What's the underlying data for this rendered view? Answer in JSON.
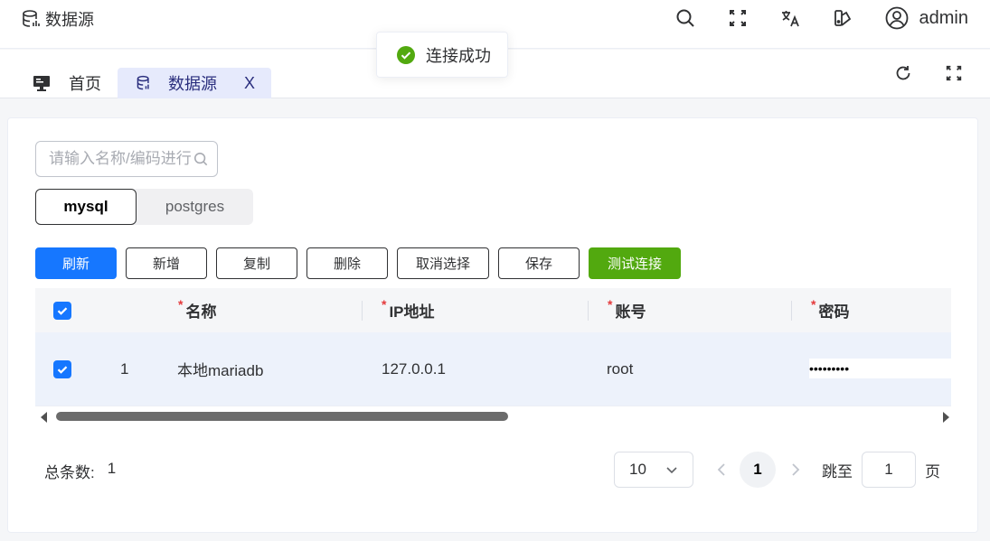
{
  "header": {
    "title": "数据源",
    "icons": [
      "search-icon",
      "fullscreen-icon",
      "translate-icon",
      "theme-icon",
      "user-icon"
    ],
    "username": "admin"
  },
  "tabs": [
    {
      "label": "首页",
      "icon": "monitor-icon",
      "active": false
    },
    {
      "label": "数据源",
      "icon": "database-icon",
      "active": true,
      "close": "X"
    }
  ],
  "toast": {
    "message": "连接成功",
    "type": "success"
  },
  "search": {
    "placeholder": "请输入名称/编码进行"
  },
  "segments": [
    {
      "label": "mysql",
      "active": true
    },
    {
      "label": "postgres",
      "active": false
    }
  ],
  "toolbar": {
    "refresh": "刷新",
    "add": "新增",
    "copy": "复制",
    "delete": "删除",
    "deselect": "取消选择",
    "save": "保存",
    "test": "测试连接"
  },
  "table": {
    "columns": [
      {
        "label": "名称",
        "required": "*"
      },
      {
        "label": "IP地址",
        "required": "*"
      },
      {
        "label": "账号",
        "required": "*"
      },
      {
        "label": "密码",
        "required": "*"
      }
    ],
    "rows": [
      {
        "index": "1",
        "name": "本地mariadb",
        "ip": "127.0.0.1",
        "account": "root",
        "password": "•••••••••",
        "checked": true
      }
    ]
  },
  "pagination": {
    "total_label": "总条数:",
    "total": "1",
    "page_size": "10",
    "current_page": "1",
    "jump_label": "跳至",
    "jump_value": "1",
    "page_suffix": "页"
  },
  "colors": {
    "primary": "#1677ff",
    "success": "#52a90f",
    "tab_active_bg": "#e6eafc"
  }
}
